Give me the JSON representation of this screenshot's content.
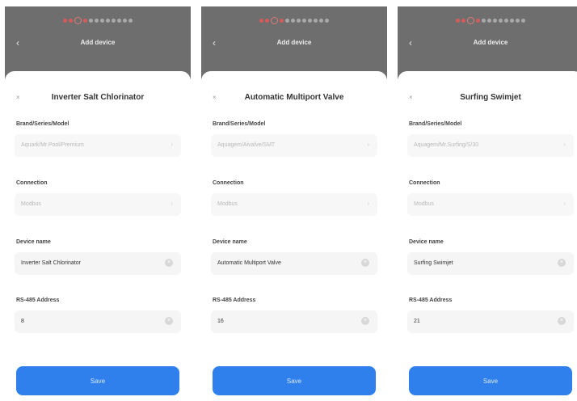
{
  "app": {
    "header_title": "Add device",
    "back_icon": "back-arrow-icon"
  },
  "labels": {
    "brand": "Brand/Series/Model",
    "connection": "Connection",
    "device_name": "Device name",
    "address": "RS-485 Address",
    "save": "Save"
  },
  "colors": {
    "header_bg": "#6e6e6e",
    "accent": "#2f80ed",
    "step_active": "#d65a5a"
  },
  "screens": [
    {
      "title": "Inverter Salt Chlorinator",
      "brand_value": "Aquark/Mr.Pool/Premium",
      "connection_value": "Modbus",
      "device_name_value": "Inverter Salt Chlorinator",
      "address_value": "8"
    },
    {
      "title": "Automatic Multiport Valve",
      "brand_value": "Aquagem/Aivalve/SMT",
      "connection_value": "Modbus",
      "device_name_value": "Automatic Multiport Valve",
      "address_value": "16"
    },
    {
      "title": "Surfing Swimjet",
      "brand_value": "Aquagem/Mr.Surfing/S/30",
      "connection_value": "Modbus",
      "device_name_value": "Surfing Swimjet",
      "address_value": "21"
    }
  ]
}
